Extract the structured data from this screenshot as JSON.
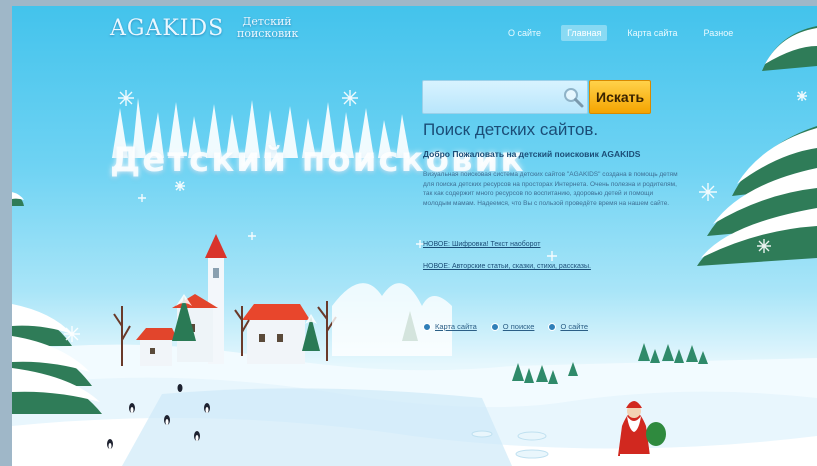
{
  "header": {
    "logo": "AGAKIDS",
    "logo_subtitle": "Детский поисковик",
    "nav": [
      {
        "label": "О сайте",
        "active": false
      },
      {
        "label": "Главная",
        "active": true
      },
      {
        "label": "Карта сайта",
        "active": false
      },
      {
        "label": "Разное",
        "active": false
      }
    ]
  },
  "hero": {
    "title": "Детский поисковик"
  },
  "search": {
    "value": "",
    "placeholder": "",
    "button_label": "Искать"
  },
  "content": {
    "heading": "Поиск детских сайтов.",
    "welcome": "Добро Пожаловать на детский поисковик AGAKIDS",
    "description": "Визуальная поисковая система детских сайтов \"AGAKIDS\" создана в помощь детям для поиска детских ресурсов на просторах Интернета. Очень полезна и родителям, так как содержит много ресурсов по воспитанию, здоровью детей и помощи молодым мамам. Надеемся, что Вы с пользой проведёте время на нашем сайте.",
    "news": [
      "НОВОЕ: Шифровка! Текст наоборот",
      "НОВОЕ: Авторские статьи, сказки, стихи, рассказы."
    ]
  },
  "footer": {
    "links": [
      "Карта сайта",
      "О поиске",
      "О сайте"
    ]
  },
  "colors": {
    "sky": "#43c3ec",
    "button": "#f5a400",
    "heading": "#1b4d77"
  }
}
